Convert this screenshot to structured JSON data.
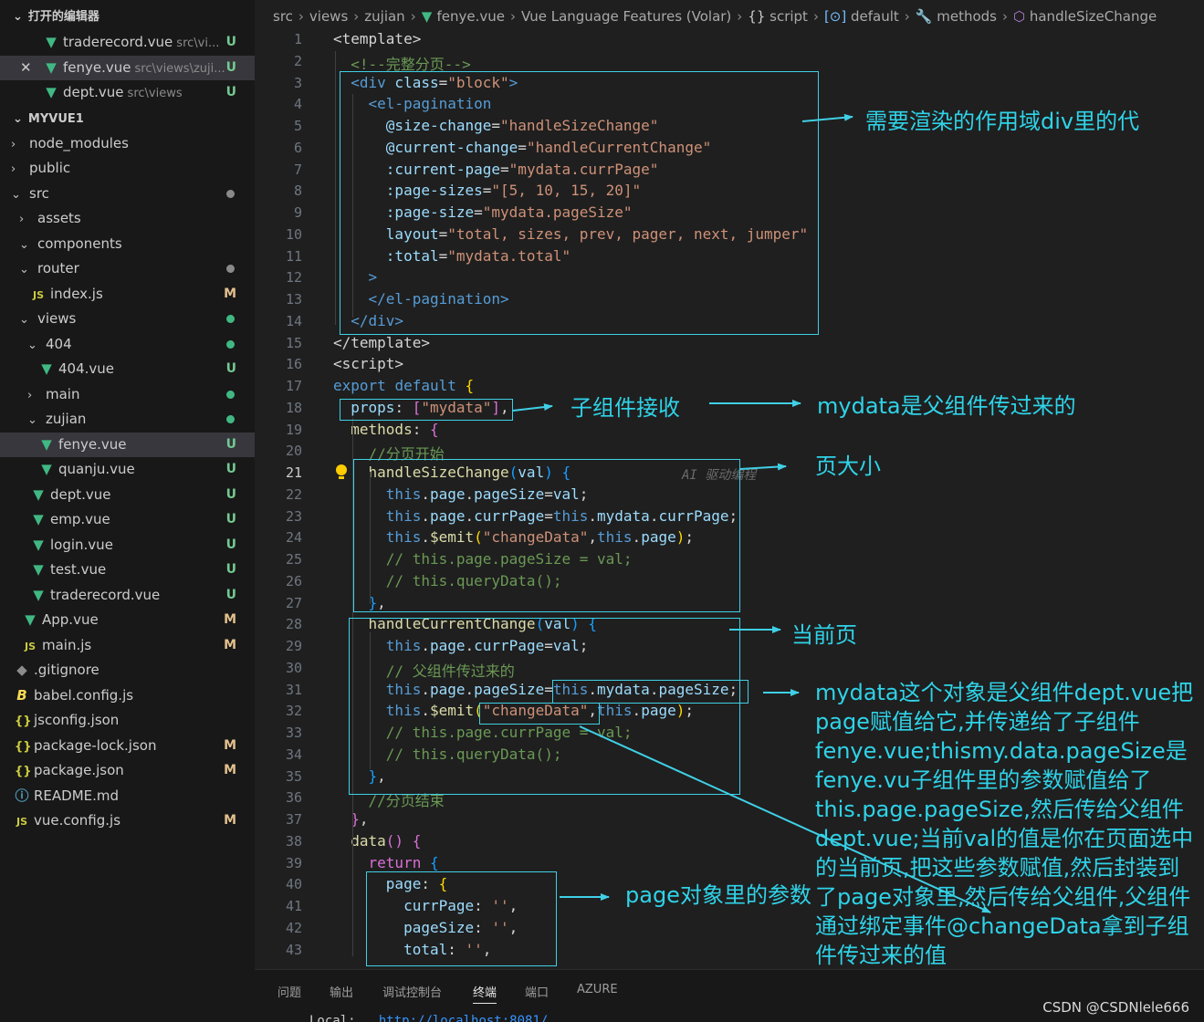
{
  "sidebar": {
    "open_editors_title": "打开的编辑器",
    "project_title": "MYVUE1",
    "open_editors": [
      {
        "label": "traderecord.vue",
        "hint": "src\\vi...",
        "badge": "U",
        "icon": "vue-icon"
      },
      {
        "label": "fenye.vue",
        "hint": "src\\views\\zuji...",
        "badge": "U",
        "icon": "vue-icon"
      },
      {
        "label": "dept.vue",
        "hint": "src\\views",
        "badge": "U",
        "icon": "vue-icon"
      }
    ],
    "close_glyph": "✕",
    "tree": [
      {
        "label": "node_modules",
        "type": "folder",
        "open": false
      },
      {
        "label": "public",
        "type": "folder",
        "open": false
      },
      {
        "label": "src",
        "type": "folder",
        "open": true
      },
      {
        "label": "assets",
        "type": "folder",
        "open": false
      },
      {
        "label": "components",
        "type": "folder",
        "open": true
      },
      {
        "label": "router",
        "type": "folder",
        "open": true
      },
      {
        "label": "index.js",
        "type": "js",
        "badge": "M"
      },
      {
        "label": "views",
        "type": "folder",
        "open": true
      },
      {
        "label": "404",
        "type": "folder",
        "open": true
      },
      {
        "label": "404.vue",
        "type": "vue",
        "badge": "U"
      },
      {
        "label": "main",
        "type": "folder",
        "open": false
      },
      {
        "label": "zujian",
        "type": "folder",
        "open": true
      },
      {
        "label": "fenye.vue",
        "type": "vue",
        "badge": "U"
      },
      {
        "label": "quanju.vue",
        "type": "vue",
        "badge": "U"
      },
      {
        "label": "dept.vue",
        "type": "vue",
        "badge": "U"
      },
      {
        "label": "emp.vue",
        "type": "vue",
        "badge": "U"
      },
      {
        "label": "login.vue",
        "type": "vue",
        "badge": "U"
      },
      {
        "label": "test.vue",
        "type": "vue",
        "badge": "U"
      },
      {
        "label": "traderecord.vue",
        "type": "vue",
        "badge": "U"
      },
      {
        "label": "App.vue",
        "type": "vue",
        "badge": "M"
      },
      {
        "label": "main.js",
        "type": "js",
        "badge": "M"
      },
      {
        "label": ".gitignore",
        "type": "git"
      },
      {
        "label": "babel.config.js",
        "type": "babel"
      },
      {
        "label": "jsconfig.json",
        "type": "json"
      },
      {
        "label": "package-lock.json",
        "type": "json",
        "badge": "M"
      },
      {
        "label": "package.json",
        "type": "json",
        "badge": "M"
      },
      {
        "label": "README.md",
        "type": "info"
      },
      {
        "label": "vue.config.js",
        "type": "js",
        "badge": "M"
      }
    ],
    "icon_text": {
      "js": "JS",
      "json": "{}",
      "info": "ⓘ",
      "git": "◆",
      "babel": "B",
      "vue": "▼"
    }
  },
  "breadcrumb": [
    "src",
    "views",
    "zujian",
    "fenye.vue",
    "Vue Language Features (Volar)",
    "script",
    "default",
    "methods",
    "handleSizeChange"
  ],
  "breadcrumb_glyphs": {
    "sep": "›",
    "script": "{}",
    "default": "[⊙]",
    "methods": "🔧",
    "handleSizeChange": "⬡"
  },
  "editor": {
    "current_line": 21,
    "lines": [
      [
        [
          "tx",
          "<template>"
        ]
      ],
      [
        [
          "cm",
          "  <!--完整分页-->"
        ]
      ],
      [
        [
          "tx",
          "  "
        ],
        [
          "tg",
          "<div"
        ],
        [
          "at",
          " class"
        ],
        [
          "tx",
          "="
        ],
        [
          "st",
          "\"block\""
        ],
        [
          "tg",
          ">"
        ]
      ],
      [
        [
          "tx",
          "    "
        ],
        [
          "tg",
          "<el-pagination"
        ]
      ],
      [
        [
          "tx",
          "      "
        ],
        [
          "at",
          "@size-change"
        ],
        [
          "tx",
          "="
        ],
        [
          "st",
          "\"handleSizeChange\""
        ]
      ],
      [
        [
          "tx",
          "      "
        ],
        [
          "at",
          "@current-change"
        ],
        [
          "tx",
          "="
        ],
        [
          "st",
          "\"handleCurrentChange\""
        ]
      ],
      [
        [
          "tx",
          "      "
        ],
        [
          "at",
          ":current-page"
        ],
        [
          "tx",
          "="
        ],
        [
          "st",
          "\"mydata.currPage\""
        ]
      ],
      [
        [
          "tx",
          "      "
        ],
        [
          "at",
          ":page-sizes"
        ],
        [
          "tx",
          "="
        ],
        [
          "st",
          "\"[5, 10, 15, 20]\""
        ]
      ],
      [
        [
          "tx",
          "      "
        ],
        [
          "at",
          ":page-size"
        ],
        [
          "tx",
          "="
        ],
        [
          "st",
          "\"mydata.pageSize\""
        ]
      ],
      [
        [
          "tx",
          "      "
        ],
        [
          "at",
          "layout"
        ],
        [
          "tx",
          "="
        ],
        [
          "st",
          "\"total, sizes, prev, pager, next, jumper\""
        ]
      ],
      [
        [
          "tx",
          "      "
        ],
        [
          "at",
          ":total"
        ],
        [
          "tx",
          "="
        ],
        [
          "st",
          "\"mydata.total\""
        ]
      ],
      [
        [
          "tx",
          "    "
        ],
        [
          "tg",
          ">"
        ]
      ],
      [
        [
          "tx",
          "    "
        ],
        [
          "tg",
          "</el-pagination>"
        ]
      ],
      [
        [
          "tx",
          "  "
        ],
        [
          "tg",
          "</div>"
        ]
      ],
      [
        [
          "tx",
          "</template>"
        ]
      ],
      [
        [
          "tx",
          "<script>"
        ]
      ],
      [
        [
          "kw",
          "export"
        ],
        [
          "tx",
          " "
        ],
        [
          "kw",
          "default"
        ],
        [
          "tx",
          " "
        ],
        [
          "yb",
          "{"
        ]
      ],
      [
        [
          "tx",
          "  "
        ],
        [
          "pr",
          "props"
        ],
        [
          "tx",
          ": "
        ],
        [
          "pb",
          "["
        ],
        [
          "st",
          "\"mydata\""
        ],
        [
          "pb",
          "]"
        ],
        [
          "tx",
          ","
        ]
      ],
      [
        [
          "tx",
          "  "
        ],
        [
          "fn",
          "methods"
        ],
        [
          "tx",
          ": "
        ],
        [
          "pb",
          "{"
        ]
      ],
      [
        [
          "cm",
          "    //分页开始"
        ]
      ],
      [
        [
          "tx",
          "    "
        ],
        [
          "fn",
          "handleSizeChange"
        ],
        [
          "bb",
          "("
        ],
        [
          "pr",
          "val"
        ],
        [
          "bb",
          ")"
        ],
        [
          "tx",
          " "
        ],
        [
          "bb",
          "{"
        ]
      ],
      [
        [
          "tx",
          "      "
        ],
        [
          "th",
          "this"
        ],
        [
          "tx",
          "."
        ],
        [
          "pr",
          "page"
        ],
        [
          "tx",
          "."
        ],
        [
          "pr",
          "pageSize"
        ],
        [
          "tx",
          "="
        ],
        [
          "pr",
          "val"
        ],
        [
          "tx",
          ";"
        ]
      ],
      [
        [
          "tx",
          "      "
        ],
        [
          "th",
          "this"
        ],
        [
          "tx",
          "."
        ],
        [
          "pr",
          "page"
        ],
        [
          "tx",
          "."
        ],
        [
          "pr",
          "currPage"
        ],
        [
          "tx",
          "="
        ],
        [
          "th",
          "this"
        ],
        [
          "tx",
          "."
        ],
        [
          "pr",
          "mydata"
        ],
        [
          "tx",
          "."
        ],
        [
          "pr",
          "currPage"
        ],
        [
          "tx",
          ";"
        ]
      ],
      [
        [
          "tx",
          "      "
        ],
        [
          "th",
          "this"
        ],
        [
          "tx",
          "."
        ],
        [
          "fn",
          "$emit"
        ],
        [
          "yb",
          "("
        ],
        [
          "st",
          "\"changeData\""
        ],
        [
          "tx",
          ","
        ],
        [
          "th",
          "this"
        ],
        [
          "tx",
          "."
        ],
        [
          "pr",
          "page"
        ],
        [
          "yb",
          ")"
        ],
        [
          "tx",
          ";"
        ]
      ],
      [
        [
          "cm",
          "      // this.page.pageSize = val;"
        ]
      ],
      [
        [
          "cm",
          "      // this.queryData();"
        ]
      ],
      [
        [
          "tx",
          "    "
        ],
        [
          "bb",
          "}"
        ],
        [
          "tx",
          ","
        ]
      ],
      [
        [
          "tx",
          "    "
        ],
        [
          "fn",
          "handleCurrentChange"
        ],
        [
          "bb",
          "("
        ],
        [
          "pr",
          "val"
        ],
        [
          "bb",
          ")"
        ],
        [
          "tx",
          " "
        ],
        [
          "bb",
          "{"
        ]
      ],
      [
        [
          "tx",
          "      "
        ],
        [
          "th",
          "this"
        ],
        [
          "tx",
          "."
        ],
        [
          "pr",
          "page"
        ],
        [
          "tx",
          "."
        ],
        [
          "pr",
          "currPage"
        ],
        [
          "tx",
          "="
        ],
        [
          "pr",
          "val"
        ],
        [
          "tx",
          ";"
        ]
      ],
      [
        [
          "cm",
          "      // 父组件传过来的"
        ]
      ],
      [
        [
          "tx",
          "      "
        ],
        [
          "th",
          "this"
        ],
        [
          "tx",
          "."
        ],
        [
          "pr",
          "page"
        ],
        [
          "tx",
          "."
        ],
        [
          "pr",
          "pageSize"
        ],
        [
          "tx",
          "="
        ],
        [
          "th",
          "this"
        ],
        [
          "tx",
          "."
        ],
        [
          "pr",
          "mydata"
        ],
        [
          "tx",
          "."
        ],
        [
          "pr",
          "pageSize"
        ],
        [
          "tx",
          ";"
        ]
      ],
      [
        [
          "tx",
          "      "
        ],
        [
          "th",
          "this"
        ],
        [
          "tx",
          "."
        ],
        [
          "fn",
          "$emit"
        ],
        [
          "yb",
          "("
        ],
        [
          "st",
          "\"changeData\""
        ],
        [
          "tx",
          ","
        ],
        [
          "th",
          "this"
        ],
        [
          "tx",
          "."
        ],
        [
          "pr",
          "page"
        ],
        [
          "yb",
          ")"
        ],
        [
          "tx",
          ";"
        ]
      ],
      [
        [
          "cm",
          "      // this.page.currPage = val;"
        ]
      ],
      [
        [
          "cm",
          "      // this.queryData();"
        ]
      ],
      [
        [
          "tx",
          "    "
        ],
        [
          "bb",
          "}"
        ],
        [
          "tx",
          ","
        ]
      ],
      [
        [
          "cm",
          "    //分页结束"
        ]
      ],
      [
        [
          "tx",
          "  "
        ],
        [
          "pb",
          "}"
        ],
        [
          "tx",
          ","
        ]
      ],
      [
        [
          "tx",
          "  "
        ],
        [
          "fn",
          "data"
        ],
        [
          "pb",
          "()"
        ],
        [
          "tx",
          " "
        ],
        [
          "pb",
          "{"
        ]
      ],
      [
        [
          "tx",
          "    "
        ],
        [
          "pb",
          "return"
        ],
        [
          "tx",
          " "
        ],
        [
          "bb",
          "{"
        ]
      ],
      [
        [
          "tx",
          "      "
        ],
        [
          "pr",
          "page"
        ],
        [
          "tx",
          ": "
        ],
        [
          "yb",
          "{"
        ]
      ],
      [
        [
          "tx",
          "        "
        ],
        [
          "pr",
          "currPage"
        ],
        [
          "tx",
          ": "
        ],
        [
          "st",
          "''"
        ],
        [
          "tx",
          ","
        ]
      ],
      [
        [
          "tx",
          "        "
        ],
        [
          "pr",
          "pageSize"
        ],
        [
          "tx",
          ": "
        ],
        [
          "st",
          "''"
        ],
        [
          "tx",
          ","
        ]
      ],
      [
        [
          "tx",
          "        "
        ],
        [
          "pr",
          "total"
        ],
        [
          "tx",
          ": "
        ],
        [
          "st",
          "''"
        ],
        [
          "tx",
          ","
        ]
      ]
    ],
    "ghost_text": "AI 驱动编程"
  },
  "annotations": [
    "需要渲染的作用域div里的代",
    "子组件接收",
    "mydata是父组件传过来的",
    "页大小",
    "当前页",
    "mydata这个对象是父组件dept.vue把\npage赋值给它,并传递给了子组件\nfenye.vue;thismy.data.pageSize是\nfenye.vu子组件里的参数赋值给了\nthis.page.pageSize,然后传给父组件\ndept.vue;当前val的值是你在页面选中\n的当前页,把这些参数赋值,然后封装到\n了page对象里,然后传给父组件,父组件\n通过绑定事件@changeData拿到子组\n件传过来的值",
    "page对象里的参数"
  ],
  "annotation_color": "#2fd3e8",
  "panel": {
    "tabs": [
      "问题",
      "输出",
      "调试控制台",
      "终端",
      "端口",
      "AZURE"
    ],
    "active_tab": "终端",
    "terminal_label": "Local:",
    "terminal_url": "http://localhost:8081/"
  },
  "watermark": "CSDN @CSDNlele666"
}
